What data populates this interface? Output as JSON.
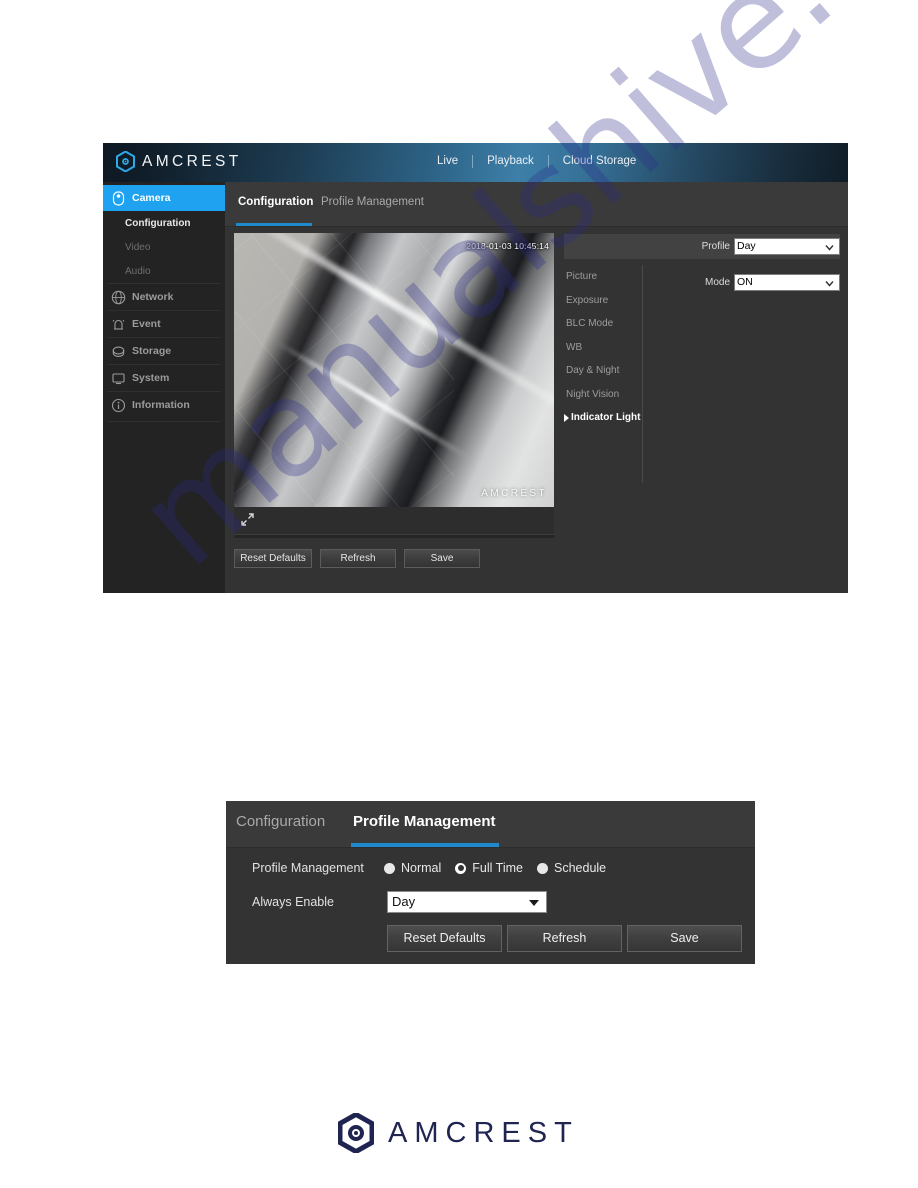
{
  "watermark": {
    "text": "manualshive.com"
  },
  "main_ui": {
    "header": {
      "brand": "AMCREST",
      "brand_mark_icon": "amcrest-hex-logo-icon",
      "nav": [
        {
          "label": "Live"
        },
        {
          "label": "Playback"
        },
        {
          "label": "Cloud Storage"
        }
      ]
    },
    "sidebar": {
      "items": [
        {
          "label": "Camera",
          "icon": "camera-icon",
          "active": true
        },
        {
          "label": "Network",
          "icon": "network-globe-icon",
          "active": false
        },
        {
          "label": "Event",
          "icon": "event-bell-icon",
          "active": false
        },
        {
          "label": "Storage",
          "icon": "storage-disk-icon",
          "active": false
        },
        {
          "label": "System",
          "icon": "system-monitor-icon",
          "active": false
        },
        {
          "label": "Information",
          "icon": "information-circle-icon",
          "active": false
        }
      ],
      "sub_items": [
        {
          "label": "Configuration",
          "current": true
        },
        {
          "label": "Video",
          "current": false
        },
        {
          "label": "Audio",
          "current": false
        }
      ]
    },
    "tabs": [
      {
        "label": "Configuration",
        "active": true
      },
      {
        "label": "Profile Management",
        "active": false
      }
    ],
    "video": {
      "timestamp": "2018-01-03 10:45:14",
      "watermark": "AMCREST",
      "expand_icon": "expand-fullscreen-icon"
    },
    "settings_list": [
      {
        "label": "Picture",
        "selected": false
      },
      {
        "label": "Exposure",
        "selected": false
      },
      {
        "label": "BLC Mode",
        "selected": false
      },
      {
        "label": "WB",
        "selected": false
      },
      {
        "label": "Day & Night",
        "selected": false
      },
      {
        "label": "Night Vision",
        "selected": false
      },
      {
        "label": "Indicator Light",
        "selected": true
      }
    ],
    "fields": {
      "profile_label": "Profile",
      "profile_value": "Day",
      "mode_label": "Mode",
      "mode_value": "ON",
      "chevron_icon": "chevron-down-icon"
    },
    "buttons": [
      {
        "label": "Reset Defaults"
      },
      {
        "label": "Refresh"
      },
      {
        "label": "Save"
      }
    ],
    "colors": {
      "accent_blue": "#1fa2f0",
      "tab_underline": "#2089cc",
      "panel_bg": "#333333",
      "sidebar_bg": "#232323"
    }
  },
  "profile_management": {
    "tabs": [
      {
        "label": "Configuration",
        "active": false
      },
      {
        "label": "Profile Management",
        "active": true
      }
    ],
    "profile_management_label": "Profile Management",
    "radio_options": [
      {
        "label": "Normal",
        "checked": false
      },
      {
        "label": "Full Time",
        "checked": true
      },
      {
        "label": "Schedule",
        "checked": false
      }
    ],
    "always_enable_label": "Always Enable",
    "always_enable_value": "Day",
    "dropdown_icon": "triangle-down-icon",
    "buttons": [
      {
        "label": "Reset Defaults"
      },
      {
        "label": "Refresh"
      },
      {
        "label": "Save"
      }
    ]
  },
  "footer": {
    "brand": "AMCREST",
    "mark_icon": "amcrest-hex-logo-icon"
  }
}
